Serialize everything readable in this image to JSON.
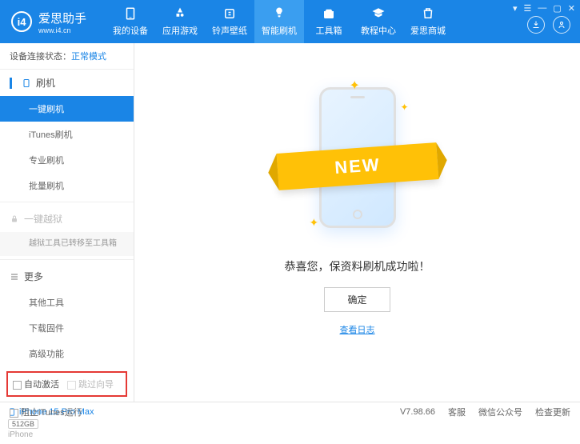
{
  "header": {
    "logo_text": "爱思助手",
    "logo_url": "www.i4.cn",
    "logo_badge": "i4"
  },
  "nav": [
    {
      "label": "我的设备",
      "icon": "device"
    },
    {
      "label": "应用游戏",
      "icon": "apps"
    },
    {
      "label": "铃声壁纸",
      "icon": "ring"
    },
    {
      "label": "智能刷机",
      "icon": "flash",
      "active": true
    },
    {
      "label": "工具箱",
      "icon": "tools"
    },
    {
      "label": "教程中心",
      "icon": "tutorial"
    },
    {
      "label": "爱思商城",
      "icon": "shop"
    }
  ],
  "win_controls": {
    "settings": "▾",
    "grid": "☰",
    "min": "—",
    "max": "▢",
    "close": "✕"
  },
  "status": {
    "label": "设备连接状态：",
    "value": "正常模式"
  },
  "sidebar": {
    "group_flash": "刷机",
    "items_flash": [
      {
        "label": "一键刷机",
        "active": true
      },
      {
        "label": "iTunes刷机"
      },
      {
        "label": "专业刷机"
      },
      {
        "label": "批量刷机"
      }
    ],
    "group_jailbreak": "一键越狱",
    "jailbreak_note": "越狱工具已转移至工具箱",
    "group_more": "更多",
    "items_more": [
      {
        "label": "其他工具"
      },
      {
        "label": "下载固件"
      },
      {
        "label": "高级功能"
      }
    ],
    "cb_auto_activate": "自动激活",
    "cb_skip_guide": "跳过向导"
  },
  "device": {
    "name": "iPhone 15 Pro Max",
    "storage": "512GB",
    "type": "iPhone"
  },
  "content": {
    "banner": "NEW",
    "success": "恭喜您，保资料刷机成功啦！",
    "ok": "确定",
    "log_link": "查看日志"
  },
  "footer": {
    "block_itunes": "阻止iTunes运行",
    "version": "V7.98.66",
    "links": [
      "客服",
      "微信公众号",
      "检查更新"
    ]
  }
}
